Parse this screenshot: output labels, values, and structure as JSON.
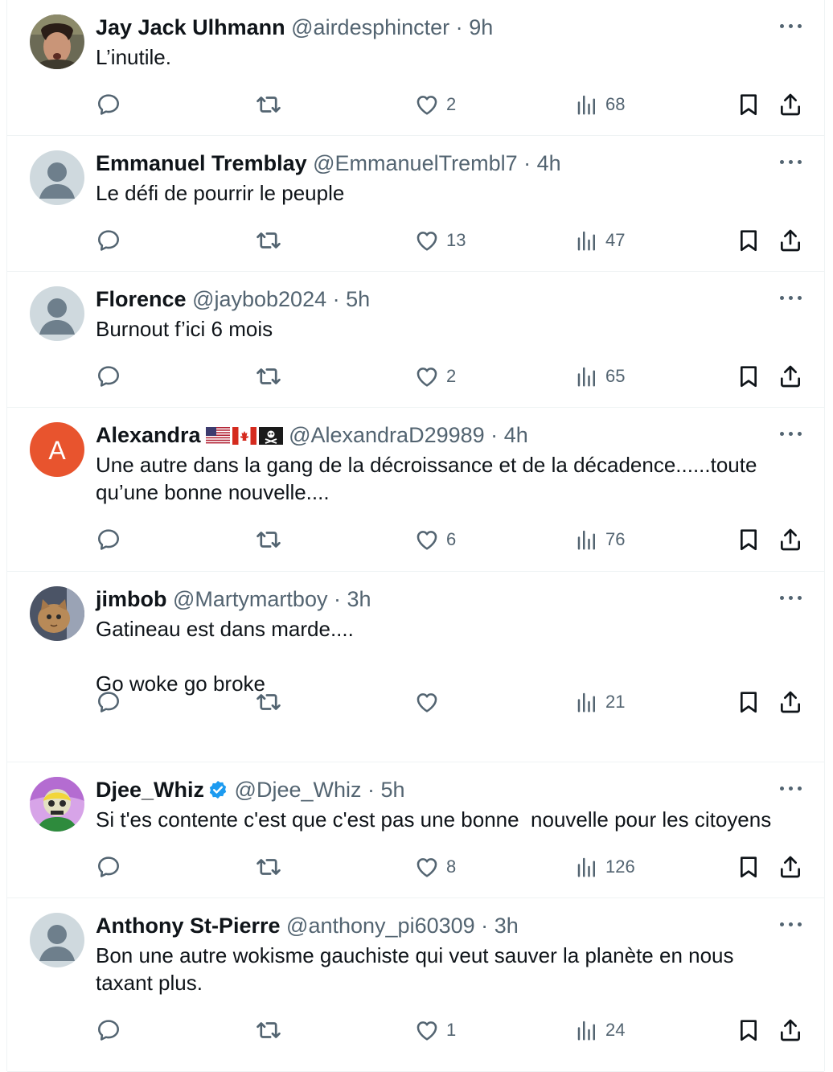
{
  "tweets": [
    {
      "name": "Jay Jack Ulhmann",
      "handle": "@airdesphincter",
      "time": "9h",
      "text": "L’inutile.",
      "likes": "2",
      "views": "68",
      "avatar": "photo"
    },
    {
      "name": "Emmanuel Tremblay",
      "handle": "@EmmanuelTrembl7",
      "time": "4h",
      "text": "Le défi de pourrir le peuple",
      "likes": "13",
      "views": "47",
      "avatar": "default"
    },
    {
      "name": "Florence",
      "handle": "@jaybob2024",
      "time": "5h",
      "text": "Burnout f’ici 6 mois",
      "likes": "2",
      "views": "65",
      "avatar": "default"
    },
    {
      "name": "Alexandra",
      "handle": "@AlexandraD29989",
      "time": "4h",
      "text": "Une autre dans la gang de la décroissance et de la décadence......toute qu’une bonne nouvelle....",
      "likes": "6",
      "views": "76",
      "avatar": "letter",
      "avatar_letter": "A",
      "avatar_color": "#e8542e",
      "flags": [
        "us-flag",
        "canada-flag",
        "pirate-flag"
      ]
    },
    {
      "name": "jimbob",
      "handle": "@Martymartboy",
      "time": "3h",
      "text": "Gatineau est dans marde....\n\nGo woke go broke",
      "likes": "",
      "views": "21",
      "avatar": "cat-photo"
    },
    {
      "name": "Djee_Whiz",
      "handle": "@Djee_Whiz",
      "time": "5h",
      "text": "Si t'es contente c'est que c'est pas une bonne  nouvelle pour les citoyens",
      "likes": "8",
      "views": "126",
      "avatar": "cartoon",
      "verified": true
    },
    {
      "name": "Anthony St-Pierre",
      "handle": "@anthony_pi60309",
      "time": "3h",
      "text": "Bon une autre wokisme gauchiste qui veut sauver la planète en nous taxant plus.",
      "likes": "1",
      "views": "24",
      "avatar": "default"
    }
  ],
  "separator": "·",
  "colors": {
    "text": "#0f1419",
    "secondary": "#536471",
    "border": "#eff3f4",
    "verified": "#1d9bf0"
  },
  "icons": [
    "reply-icon",
    "retweet-icon",
    "like-icon",
    "views-icon",
    "bookmark-icon",
    "share-icon",
    "more-icon",
    "verified-icon"
  ]
}
